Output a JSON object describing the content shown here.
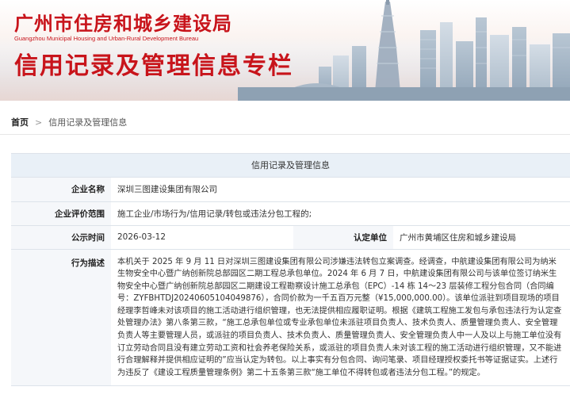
{
  "banner": {
    "org_title": "广州市住房和城乡建设局",
    "org_en": "Guangzhou Municipal Housing and Urban-Rural Development Bureau",
    "page_heading": "信用记录及管理信息专栏"
  },
  "breadcrumb": {
    "home": "首页",
    "current": "信用记录及管理信息"
  },
  "panel": {
    "title": "信用记录及管理信息",
    "company_label": "企业名称",
    "company_value": "深圳三图建设集团有限公司",
    "scope_label": "企业评价范围",
    "scope_value": "施工企业/市场行为/信用记录/转包或违法分包工程的;",
    "date_label": "公示时间",
    "date_value": "2026-03-12",
    "authority_label": "认定单位",
    "authority_value": "广州市黄埔区住房和城乡建设局",
    "behavior_label": "行为描述",
    "behavior_value": "本机关于 2025 年 9 月 11 日对深圳三图建设集团有限公司涉嫌违法转包立案调查。经调查，中航建设集团有限公司为纳米生物安全中心暨广纳创新院总部园区二期工程总承包单位。2024 年 6 月 7 日，中航建设集团有限公司与该单位签订纳米生物安全中心暨广纳创新院总部园区二期建设工程勘察设计施工总承包（EPC）-14 栋 14～23 层装修工程分包合同（合同编号：ZYFBHTDJ20240605104049876），合同价款为一千五百万元整（¥15,000,000.00）。该单位派驻到项目现场的项目经理李哲峰未对该项目的施工活动进行组织管理，也无法提供相应履职证明。根据《建筑工程施工发包与承包违法行为认定查处管理办法》第八条第三款，“施工总承包单位或专业承包单位未派驻项目负责人、技术负责人、质量管理负责人、安全管理负责人等主要管理人员，或派驻的项目负责人、技术负责人、质量管理负责人、安全管理负责人中一人及以上与施工单位没有订立劳动合同且没有建立劳动工资和社会养老保险关系，或派驻的项目负责人未对该工程的施工活动进行组织管理，又不能进行合理解释并提供相应证明的”应当认定为转包。以上事实有分包合同、询问笔录、项目经理授权委托书等证据证实。上述行为违反了《建设工程质量管理条例》第二十五条第三款“施工单位不得转包或者违法分包工程。”的规定。"
  },
  "colors": {
    "brand_red": "#c8141b",
    "panel_header_bg": "#e9f0f7",
    "label_bg": "#f5f7fa"
  }
}
